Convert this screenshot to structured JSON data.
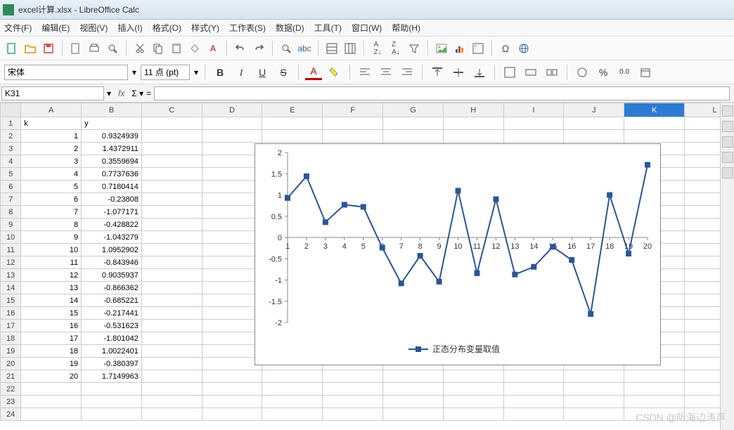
{
  "title": "excel计算.xlsx - LibreOffice Calc",
  "menus": [
    "文件(F)",
    "编辑(E)",
    "视图(V)",
    "插入(I)",
    "格式(O)",
    "样式(Y)",
    "工作表(S)",
    "数据(D)",
    "工具(T)",
    "窗口(W)",
    "帮助(H)"
  ],
  "font": {
    "name": "宋体",
    "size": "11 点 (pt)"
  },
  "cellref": "K31",
  "columns": [
    "A",
    "B",
    "C",
    "D",
    "E",
    "F",
    "G",
    "H",
    "I",
    "J",
    "K",
    "L"
  ],
  "selected_col": "K",
  "rows": 24,
  "headers": {
    "A": "k",
    "B": "y"
  },
  "data": [
    {
      "k": 1,
      "y": "0.9324939"
    },
    {
      "k": 2,
      "y": "1.4372911"
    },
    {
      "k": 3,
      "y": "0.3559694"
    },
    {
      "k": 4,
      "y": "0.7737636"
    },
    {
      "k": 5,
      "y": "0.7180414"
    },
    {
      "k": 6,
      "y": "-0.23808"
    },
    {
      "k": 7,
      "y": "-1.077171"
    },
    {
      "k": 8,
      "y": "-0.428822"
    },
    {
      "k": 9,
      "y": "-1.043279"
    },
    {
      "k": 10,
      "y": "1.0952902"
    },
    {
      "k": 11,
      "y": "-0.843946"
    },
    {
      "k": 12,
      "y": "0.9035937"
    },
    {
      "k": 13,
      "y": "-0.866362"
    },
    {
      "k": 14,
      "y": "-0.685221"
    },
    {
      "k": 15,
      "y": "-0.217441"
    },
    {
      "k": 16,
      "y": "-0.531623"
    },
    {
      "k": 17,
      "y": "-1.801042"
    },
    {
      "k": 18,
      "y": "1.0022401"
    },
    {
      "k": 19,
      "y": "-0.380397"
    },
    {
      "k": 20,
      "y": "1.7149963"
    }
  ],
  "chart_data": {
    "type": "line",
    "title": "正态分布变量取值",
    "xlabel": "",
    "ylabel": "",
    "ylim": [
      -2,
      2
    ],
    "yticks": [
      -2,
      -1.5,
      -1,
      -0.5,
      0,
      0.5,
      1,
      1.5,
      2
    ],
    "categories": [
      1,
      2,
      3,
      4,
      5,
      6,
      7,
      8,
      9,
      10,
      11,
      12,
      13,
      14,
      15,
      16,
      17,
      18,
      19,
      20
    ],
    "series": [
      {
        "name": "正态分布变量取值",
        "values": [
          0.93,
          1.44,
          0.36,
          0.77,
          0.72,
          -0.24,
          -1.08,
          -0.43,
          -1.04,
          1.1,
          -0.84,
          0.9,
          -0.87,
          -0.69,
          -0.22,
          -0.53,
          -1.8,
          1.0,
          -0.38,
          1.71
        ]
      }
    ]
  },
  "watermark": "CSDN @听海边涛声"
}
